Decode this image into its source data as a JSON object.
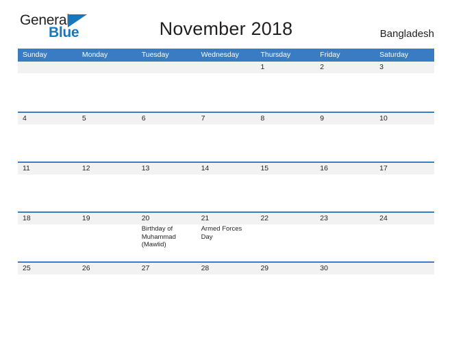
{
  "brand": {
    "name_top": "General",
    "name_bottom": "Blue",
    "accent_color": "#1878be"
  },
  "header": {
    "title": "November 2018",
    "country": "Bangladesh"
  },
  "theme": {
    "header_blue": "#3a7cc4",
    "day_band_gray": "#f2f2f2",
    "text_color": "#231f20"
  },
  "calendar": {
    "weekdays": [
      "Sunday",
      "Monday",
      "Tuesday",
      "Wednesday",
      "Thursday",
      "Friday",
      "Saturday"
    ],
    "weeks": [
      {
        "days": [
          {
            "number": "",
            "event": ""
          },
          {
            "number": "",
            "event": ""
          },
          {
            "number": "",
            "event": ""
          },
          {
            "number": "",
            "event": ""
          },
          {
            "number": "1",
            "event": ""
          },
          {
            "number": "2",
            "event": ""
          },
          {
            "number": "3",
            "event": ""
          }
        ]
      },
      {
        "days": [
          {
            "number": "4",
            "event": ""
          },
          {
            "number": "5",
            "event": ""
          },
          {
            "number": "6",
            "event": ""
          },
          {
            "number": "7",
            "event": ""
          },
          {
            "number": "8",
            "event": ""
          },
          {
            "number": "9",
            "event": ""
          },
          {
            "number": "10",
            "event": ""
          }
        ]
      },
      {
        "days": [
          {
            "number": "11",
            "event": ""
          },
          {
            "number": "12",
            "event": ""
          },
          {
            "number": "13",
            "event": ""
          },
          {
            "number": "14",
            "event": ""
          },
          {
            "number": "15",
            "event": ""
          },
          {
            "number": "16",
            "event": ""
          },
          {
            "number": "17",
            "event": ""
          }
        ]
      },
      {
        "days": [
          {
            "number": "18",
            "event": ""
          },
          {
            "number": "19",
            "event": ""
          },
          {
            "number": "20",
            "event": "Birthday of Muhammad (Mawlid)"
          },
          {
            "number": "21",
            "event": "Armed Forces Day"
          },
          {
            "number": "22",
            "event": ""
          },
          {
            "number": "23",
            "event": ""
          },
          {
            "number": "24",
            "event": ""
          }
        ]
      },
      {
        "days": [
          {
            "number": "25",
            "event": ""
          },
          {
            "number": "26",
            "event": ""
          },
          {
            "number": "27",
            "event": ""
          },
          {
            "number": "28",
            "event": ""
          },
          {
            "number": "29",
            "event": ""
          },
          {
            "number": "30",
            "event": ""
          },
          {
            "number": "",
            "event": ""
          }
        ]
      }
    ]
  }
}
